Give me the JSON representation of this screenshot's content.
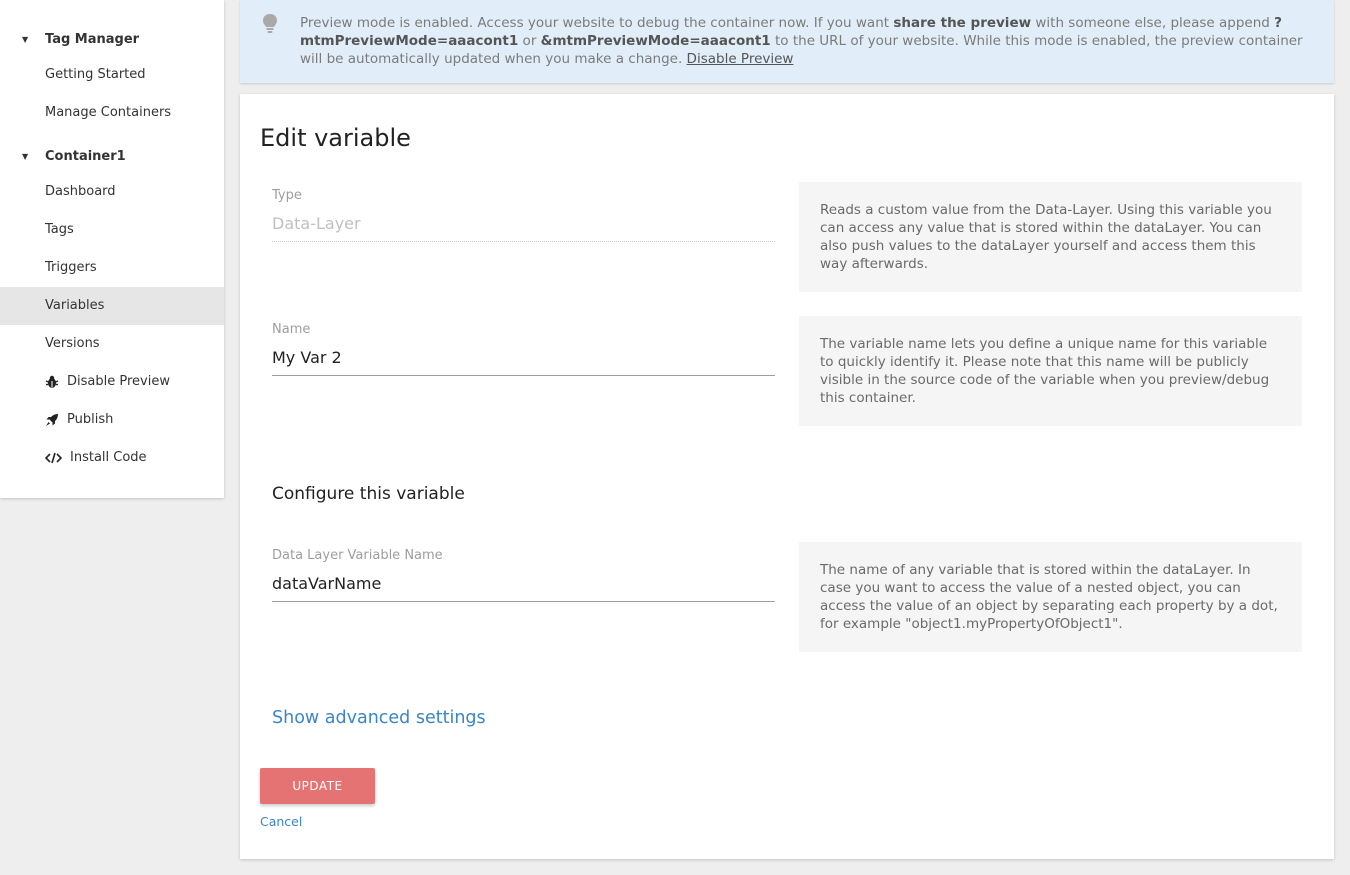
{
  "sidebar": {
    "sections": [
      {
        "label": "Tag Manager"
      },
      {
        "label": "Container1"
      }
    ],
    "tag_manager_items": [
      {
        "label": "Getting Started"
      },
      {
        "label": "Manage Containers"
      }
    ],
    "container_items": [
      {
        "label": "Dashboard"
      },
      {
        "label": "Tags"
      },
      {
        "label": "Triggers"
      },
      {
        "label": "Variables",
        "active": true
      },
      {
        "label": "Versions"
      },
      {
        "label": "Disable Preview",
        "icon": "bug-icon"
      },
      {
        "label": "Publish",
        "icon": "rocket-icon"
      },
      {
        "label": "Install Code",
        "icon": "code-icon"
      }
    ]
  },
  "notice": {
    "icon": "lightbulb-icon",
    "text_1": "Preview mode is enabled. Access your website to debug the container now. If you want ",
    "bold_1": "share the preview",
    "text_2": " with someone else, please append ",
    "bold_2": "?mtmPreviewMode=aaacont1",
    "text_3": " or ",
    "bold_3": "&mtmPreviewMode=aaacont1",
    "text_4": " to the URL of your website. While this mode is enabled, the preview container will be automatically updated when you make a change. ",
    "link": "Disable Preview"
  },
  "form": {
    "title": "Edit variable",
    "type": {
      "label": "Type",
      "value": "Data-Layer",
      "help": "Reads a custom value from the Data-Layer. Using this variable you can access any value that is stored within the dataLayer. You can also push values to the dataLayer yourself and access them this way afterwards."
    },
    "name": {
      "label": "Name",
      "value": "My Var 2",
      "help": "The variable name lets you define a unique name for this variable to quickly identify it. Please note that this name will be publicly visible in the source code of the variable when you preview/debug this container."
    },
    "configure_title": "Configure this variable",
    "data_layer_name": {
      "label": "Data Layer Variable Name",
      "value": "dataVarName",
      "help": "The name of any variable that is stored within the dataLayer. In case you want to access the value of a nested object, you can access the value of an object by separating each property by a dot, for example \"object1.myPropertyOfObject1\"."
    },
    "advanced_link": "Show advanced settings",
    "update_button": "UPDATE",
    "cancel_link": "Cancel"
  },
  "colors": {
    "accent": "#e57373",
    "link": "#3b86c4",
    "notice_bg": "#e1eef9"
  }
}
